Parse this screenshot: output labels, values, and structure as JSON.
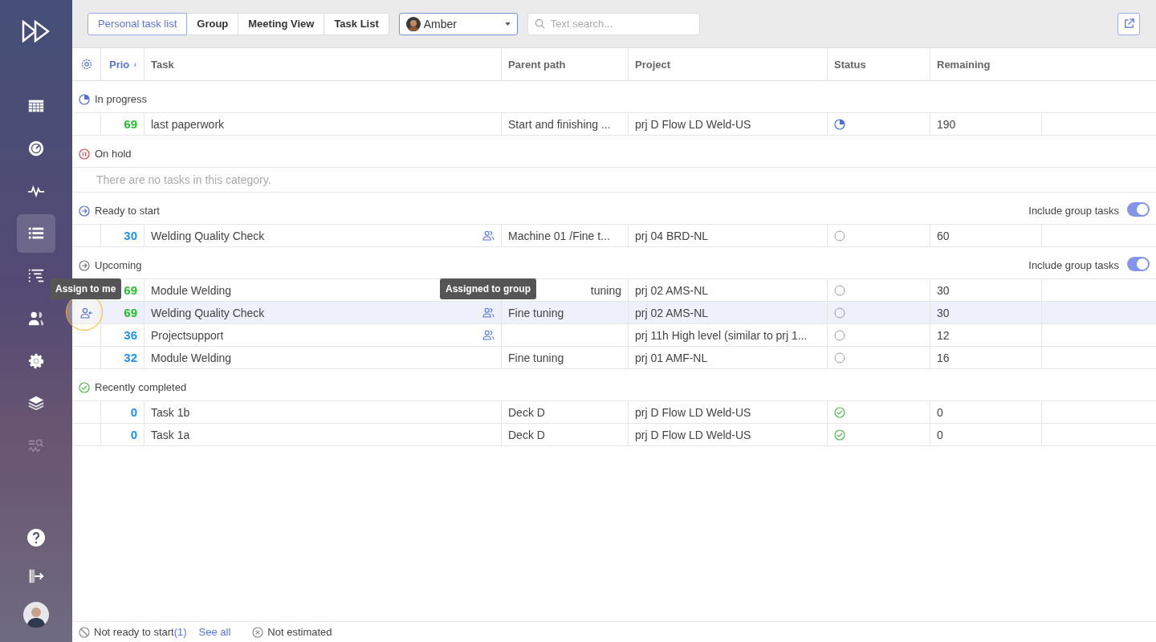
{
  "sidebar": {
    "items": [
      {
        "kind": "calendar",
        "selected": false,
        "disabled": false
      },
      {
        "kind": "gauge",
        "selected": false,
        "disabled": false
      },
      {
        "kind": "pulse",
        "selected": false,
        "disabled": false
      },
      {
        "kind": "list",
        "selected": true,
        "disabled": false
      },
      {
        "kind": "tree",
        "selected": false,
        "disabled": false
      },
      {
        "kind": "people",
        "selected": false,
        "disabled": false
      },
      {
        "kind": "gear",
        "selected": false,
        "disabled": false
      },
      {
        "kind": "layers",
        "selected": false,
        "disabled": false
      },
      {
        "kind": "search-pulse",
        "selected": false,
        "disabled": true
      }
    ],
    "bottom": [
      {
        "kind": "help"
      },
      {
        "kind": "logout"
      },
      {
        "kind": "avatar"
      }
    ]
  },
  "tabs": [
    {
      "label": "Personal task list",
      "selected": true
    },
    {
      "label": "Group",
      "selected": false
    },
    {
      "label": "Meeting View",
      "selected": false
    },
    {
      "label": "Task List",
      "selected": false
    }
  ],
  "user_select": {
    "value": "Amber"
  },
  "search": {
    "placeholder": "Text search..."
  },
  "table": {
    "columns": [
      "Prio",
      "Task",
      "Parent path",
      "Project",
      "Status",
      "Remaining"
    ],
    "sections": [
      {
        "title": "In progress",
        "kind": "progress",
        "rows": [
          {
            "prio": "69",
            "color": "#22c02a",
            "task": "last paperwork",
            "group": false,
            "parent": "Start and finishing ...",
            "project": "prj D Flow LD Weld-US",
            "kind": "progress",
            "remaining": "190",
            "selected": false
          }
        ]
      },
      {
        "title": "On hold",
        "kind": "hold",
        "empty": "There are no tasks in this category."
      },
      {
        "title": "Ready to start",
        "kind": "ready",
        "toggle": {
          "label": "Include group tasks",
          "on": true
        },
        "rows": [
          {
            "prio": "30",
            "color": "#1e90ff",
            "task": "Welding Quality Check",
            "group": true,
            "parent": "Machine 01 /Fine t...",
            "project": "prj 04 BRD-NL",
            "kind": "open",
            "remaining": "60",
            "selected": false
          }
        ]
      },
      {
        "title": "Upcoming",
        "kind": "upcoming",
        "toggle": {
          "label": "Include group tasks",
          "on": true
        },
        "rows": [
          {
            "prio": "69",
            "color": "#22c02a",
            "task": "Module Welding",
            "group": false,
            "parent": "tuning",
            "project": "prj 02 AMS-NL",
            "kind": "open",
            "remaining": "30",
            "selected": false
          },
          {
            "prio": "69",
            "color": "#22c02a",
            "task": "Welding Quality Check",
            "group": true,
            "parent": "Fine tuning",
            "project": "prj 02 AMS-NL",
            "kind": "open",
            "remaining": "30",
            "selected": true,
            "assign_tooltip": "Assign to me",
            "group_tooltip": "Assigned to group"
          },
          {
            "prio": "36",
            "color": "#1e90ff",
            "task": "Projectsupport",
            "group": true,
            "project": "prj 11h High level (similar to prj 1...",
            "kind": "open",
            "remaining": "12",
            "selected": false
          },
          {
            "prio": "32",
            "color": "#1e90ff",
            "task": "Module Welding",
            "group": false,
            "parent": "Fine tuning",
            "project": "prj 01 AMF-NL",
            "kind": "open",
            "remaining": "16",
            "selected": false
          }
        ]
      },
      {
        "title": "Recently completed",
        "kind": "done",
        "rows": [
          {
            "prio": "0",
            "color": "#1e90ff",
            "task": "Task 1b",
            "group": false,
            "parent": "Deck D",
            "project": "prj D Flow LD Weld-US",
            "kind": "done",
            "remaining": "0",
            "selected": false
          },
          {
            "prio": "0",
            "color": "#1e90ff",
            "task": "Task 1a",
            "group": false,
            "parent": "Deck D",
            "project": "prj D Flow LD Weld-US",
            "kind": "done",
            "remaining": "0",
            "selected": false
          }
        ]
      }
    ]
  },
  "footer": {
    "not_ready": "Not ready to start",
    "count": "(1)",
    "link": "See all",
    "not_estimated": "Not estimated"
  }
}
